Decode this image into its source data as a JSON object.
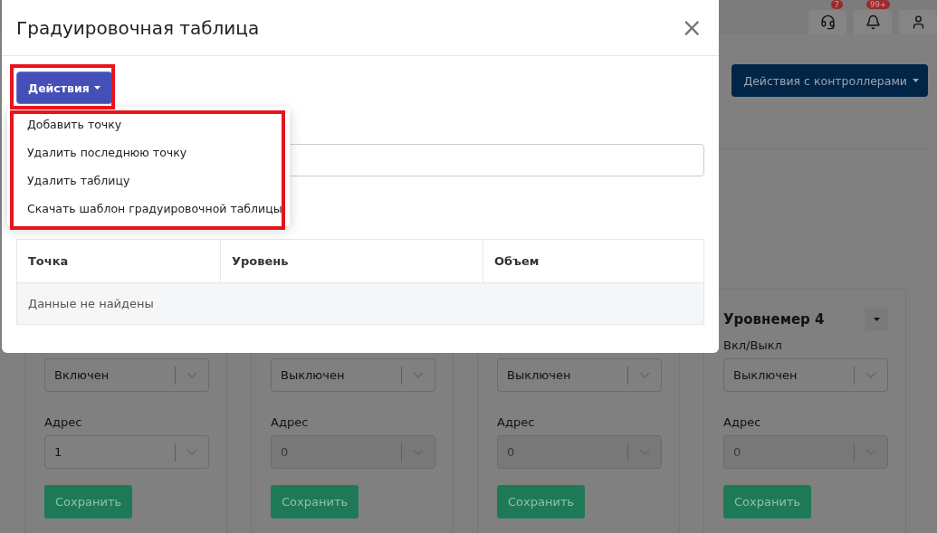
{
  "top_bar": {
    "icons": [
      {
        "kind": "headset",
        "badge": "7"
      },
      {
        "kind": "bell",
        "badge": "99+"
      },
      {
        "kind": "user"
      }
    ]
  },
  "controllers_button": "Действия с контроллерами",
  "cards": [
    {
      "toggle": {
        "value": "Включен"
      },
      "address_label": "Адрес",
      "address": {
        "value": "1",
        "disabled": false
      },
      "save_button": "Сохранить"
    },
    {
      "toggle": {
        "value": "Выключен"
      },
      "address_label": "Адрес",
      "address": {
        "value": "0",
        "disabled": true
      },
      "save_button": "Сохранить"
    },
    {
      "toggle": {
        "value": "Выключен"
      },
      "address_label": "Адрес",
      "address": {
        "value": "0",
        "disabled": true
      },
      "save_button": "Сохранить"
    },
    {
      "title": "Уровнемер 4",
      "toggle_label": "Вкл/Выкл",
      "toggle": {
        "value": "Выключен"
      },
      "address_label": "Адрес",
      "address": {
        "value": "0",
        "disabled": true
      },
      "save_button": "Сохранить"
    }
  ],
  "modal": {
    "title": "Градуировочная таблица",
    "close": "×",
    "actions_button": "Действия",
    "menu": [
      "Добавить точку",
      "Удалить последнюю точку",
      "Удалить таблицу",
      "Скачать шаблон градуировочной таблицы"
    ],
    "table": {
      "columns": [
        "Точка",
        "Уровень",
        "Объем"
      ],
      "empty_text": "Данные не найдены"
    }
  }
}
